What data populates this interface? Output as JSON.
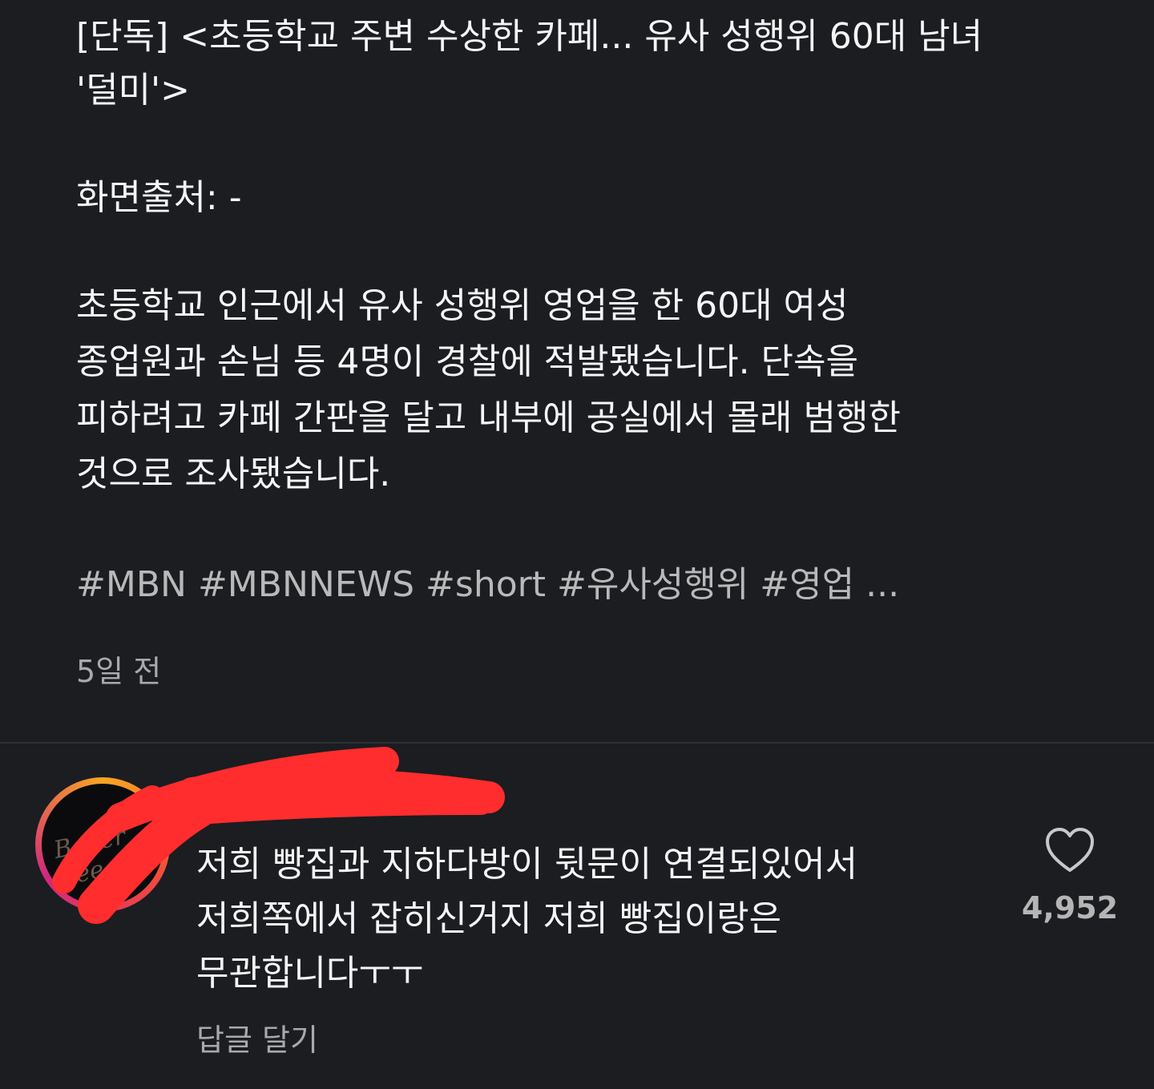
{
  "post": {
    "title": "[단독] <초등학교 주변 수상한 카페... 유사 성행위 60대 남녀\n'덜미'>",
    "source": "화면출처: -",
    "body": "초등학교 인근에서 유사 성행위 영업을 한 60대 여성\n종업원과 손님 등 4명이 경찰에 적발됐습니다. 단속을\n피하려고 카페 간판을 달고 내부에 공실에서 몰래 범행한\n것으로 조사됐습니다.",
    "hashtags": [
      "#MBN",
      "#MBNNEWS",
      "#short",
      "#유사성행위",
      "#영업"
    ],
    "hashtags_more": "...",
    "time": "5일 전"
  },
  "comment": {
    "avatar_logo": "Baker Lee",
    "text": "저희 빵집과 지하다방이 뒷문이 연결되있어서\n저희쪽에서 잡히신거지 저희 빵집이랑은\n무관합니다ㅜㅜ",
    "reply_label": "답글 달기",
    "like_icon": "heart-icon",
    "like_count": "4,952"
  },
  "colors": {
    "background": "#1b1d21",
    "text": "#f5f5f5",
    "muted": "#a9a9a9",
    "redaction": "#ff2d2d"
  }
}
